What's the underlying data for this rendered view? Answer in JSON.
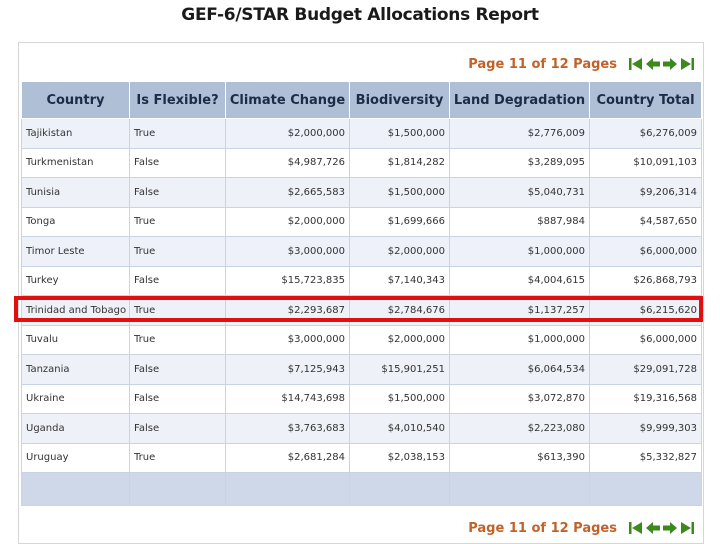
{
  "report": {
    "title": "GEF-6/STAR Budget Allocations Report",
    "page_indicator_top": "Page 11 of 12 Pages",
    "page_indicator_bottom": "Page 11 of 12 Pages",
    "nav_icons": [
      "first-page-icon",
      "previous-page-icon",
      "next-page-icon",
      "last-page-icon"
    ]
  },
  "table": {
    "headers": [
      "Country",
      "Is Flexible?",
      "Climate Change",
      "Biodiversity",
      "Land Degradation",
      "Country Total"
    ],
    "rows": [
      [
        "Tajikistan",
        "True",
        "$2,000,000",
        "$1,500,000",
        "$2,776,009",
        "$6,276,009"
      ],
      [
        "Turkmenistan",
        "False",
        "$4,987,726",
        "$1,814,282",
        "$3,289,095",
        "$10,091,103"
      ],
      [
        "Tunisia",
        "False",
        "$2,665,583",
        "$1,500,000",
        "$5,040,731",
        "$9,206,314"
      ],
      [
        "Tonga",
        "True",
        "$2,000,000",
        "$1,699,666",
        "$887,984",
        "$4,587,650"
      ],
      [
        "Timor Leste",
        "True",
        "$3,000,000",
        "$2,000,000",
        "$1,000,000",
        "$6,000,000"
      ],
      [
        "Turkey",
        "False",
        "$15,723,835",
        "$7,140,343",
        "$4,004,615",
        "$26,868,793"
      ],
      [
        "Trinidad and Tobago",
        "True",
        "$2,293,687",
        "$2,784,676",
        "$1,137,257",
        "$6,215,620"
      ],
      [
        "Tuvalu",
        "True",
        "$3,000,000",
        "$2,000,000",
        "$1,000,000",
        "$6,000,000"
      ],
      [
        "Tanzania",
        "False",
        "$7,125,943",
        "$15,901,251",
        "$6,064,534",
        "$29,091,728"
      ],
      [
        "Ukraine",
        "False",
        "$14,743,698",
        "$1,500,000",
        "$3,072,870",
        "$19,316,568"
      ],
      [
        "Uganda",
        "False",
        "$3,763,683",
        "$4,010,540",
        "$2,223,080",
        "$9,999,303"
      ],
      [
        "Uruguay",
        "True",
        "$2,681,284",
        "$2,038,153",
        "$613,390",
        "$5,332,827"
      ]
    ],
    "highlighted_row": "Trinidad and Tobago"
  },
  "colors": {
    "header_bg": "#aebfd6",
    "pager_text": "#c0632a",
    "nav_icon": "#3c8a1e",
    "highlight_border": "#e01010"
  }
}
